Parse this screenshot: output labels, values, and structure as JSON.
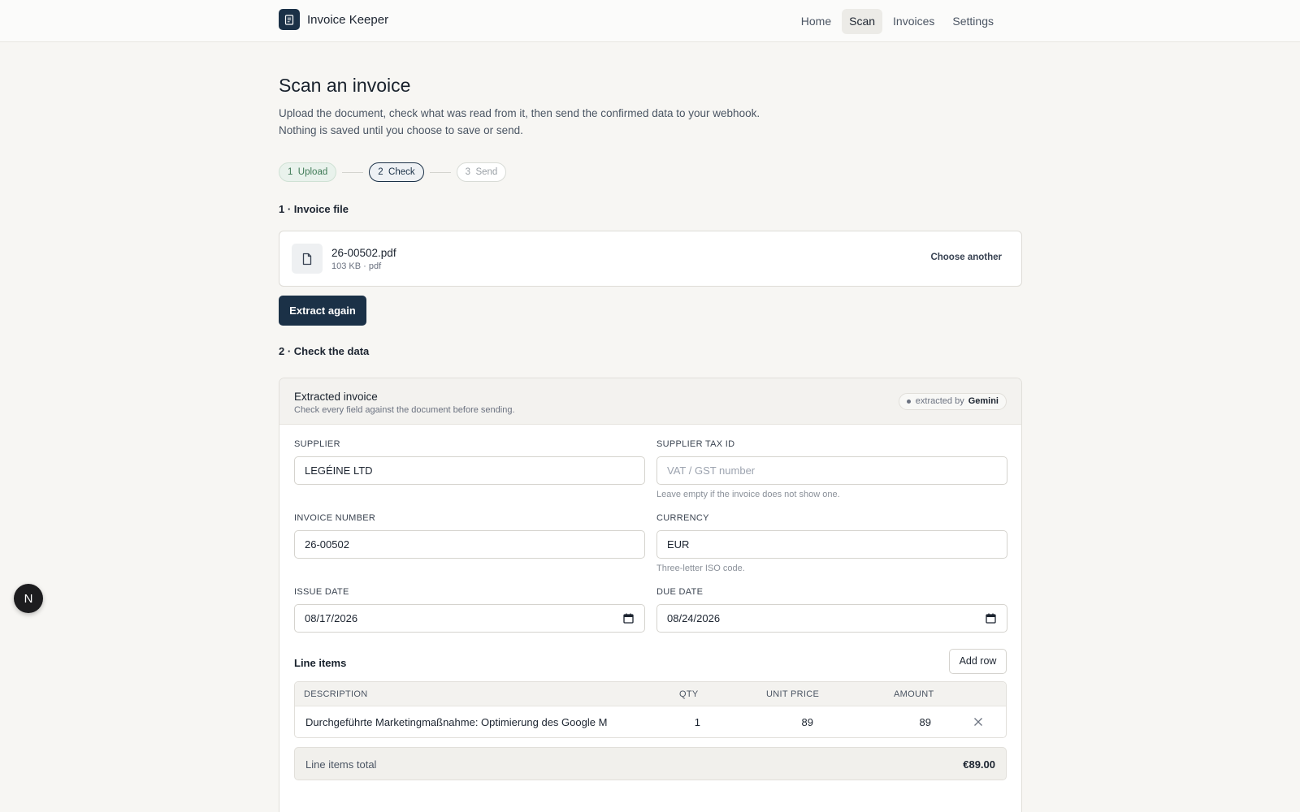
{
  "app": {
    "name": "Invoice Keeper"
  },
  "nav": {
    "items": [
      {
        "label": "Home"
      },
      {
        "label": "Scan"
      },
      {
        "label": "Invoices"
      },
      {
        "label": "Settings"
      }
    ],
    "active": "Scan"
  },
  "page": {
    "title": "Scan an invoice",
    "description": "Upload the document, check what was read from it, then send the confirmed data to your webhook. Nothing is saved until you choose to save or send."
  },
  "steps": [
    {
      "num": "1",
      "label": "Upload",
      "state": "done"
    },
    {
      "num": "2",
      "label": "Check",
      "state": "current"
    },
    {
      "num": "3",
      "label": "Send",
      "state": "todo"
    }
  ],
  "file_section": {
    "title": "1 · Invoice file",
    "file_name": "26-00502.pdf",
    "file_meta": "103 KB · pdf",
    "choose_label": "Choose another",
    "extract_label": "Extract again"
  },
  "data_section": {
    "title": "2 · Check the data",
    "card_title": "Extracted invoice",
    "card_subtitle": "Check every field against the document before sending.",
    "badge_prefix": "extracted by",
    "badge_provider": "Gemini"
  },
  "fields": {
    "supplier": {
      "label": "SUPPLIER",
      "value": "LEGÉINE LTD"
    },
    "supplier_tax_id": {
      "label": "SUPPLIER TAX ID",
      "value": "",
      "placeholder": "VAT / GST number",
      "hint": "Leave empty if the invoice does not show one."
    },
    "invoice_number": {
      "label": "INVOICE NUMBER",
      "value": "26-00502"
    },
    "currency": {
      "label": "CURRENCY",
      "value": "EUR",
      "hint": "Three-letter ISO code."
    },
    "issue_date": {
      "label": "ISSUE DATE",
      "value": "08/17/2026"
    },
    "due_date": {
      "label": "DUE DATE",
      "value": "08/24/2026"
    }
  },
  "line_items": {
    "title": "Line items",
    "add_label": "Add row",
    "columns": {
      "description": "DESCRIPTION",
      "qty": "QTY",
      "unit_price": "UNIT PRICE",
      "amount": "AMOUNT"
    },
    "rows": [
      {
        "description": "Durchgeführte Marketingmaßnahme: Optimierung des Google M",
        "qty": "1",
        "unit_price": "89",
        "amount": "89"
      }
    ],
    "total_label": "Line items total",
    "total_value": "€89.00"
  },
  "fab": {
    "label": "N"
  },
  "colors": {
    "primary": "#1b3147",
    "success": "#3f7a56",
    "background": "#f7f6f3"
  }
}
